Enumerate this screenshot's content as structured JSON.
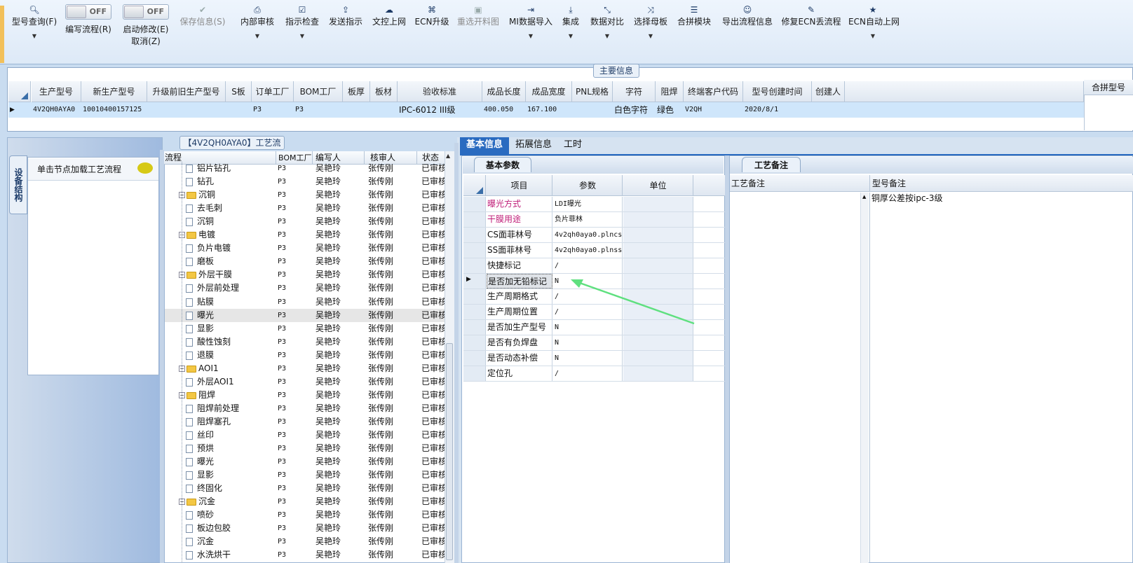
{
  "toolbar": {
    "items": [
      {
        "label": "型号查询(F)",
        "icon": "search-icon",
        "glyph": "🔍︎",
        "dropdown": true
      },
      {
        "label": "编写流程(R)",
        "toggle": "OFF"
      },
      {
        "label": "启动修改(E)",
        "label2": "取消(Z)",
        "toggle": "OFF"
      },
      {
        "label": "保存信息(S)",
        "icon": "check-icon",
        "glyph": "✔",
        "disabled": true
      },
      {
        "label": "内部审核",
        "icon": "printer-icon",
        "glyph": "⎙",
        "dropdown": true
      },
      {
        "label": "指示检查",
        "icon": "checkbox-icon",
        "glyph": "☑",
        "dropdown": true
      },
      {
        "label": "发送指示",
        "icon": "upload-icon",
        "glyph": "⇪"
      },
      {
        "label": "文控上网",
        "icon": "cloud-upload-icon",
        "glyph": "☁"
      },
      {
        "label": "ECN升级",
        "icon": "binoculars-icon",
        "glyph": "⌘"
      },
      {
        "label": "重选开料图",
        "icon": "image-icon",
        "glyph": "▣",
        "disabled": true
      },
      {
        "label": "MI数据导入",
        "icon": "import-icon",
        "glyph": "⇥",
        "dropdown": true
      },
      {
        "label": "集成",
        "icon": "download-icon",
        "glyph": "⤓",
        "dropdown": true
      },
      {
        "label": "数据对比",
        "icon": "compress-icon",
        "glyph": "⤡",
        "dropdown": true
      },
      {
        "label": "选择母板",
        "icon": "shuffle-icon",
        "glyph": "⤨",
        "dropdown": true
      },
      {
        "label": "合拼模块",
        "icon": "list-icon",
        "glyph": "☰"
      },
      {
        "label": "导出流程信息",
        "icon": "smile-icon",
        "glyph": "☺"
      },
      {
        "label": "修复ECN丢流程",
        "icon": "wrench-icon",
        "glyph": "✎"
      },
      {
        "label": "ECN自动上网",
        "icon": "star-icon",
        "glyph": "★",
        "dropdown": true
      }
    ]
  },
  "main_info": {
    "title": "主要信息",
    "columns": [
      "生产型号",
      "新生产型号",
      "升级前旧生产型号",
      "S板",
      "订单工厂",
      "BOM工厂",
      "板厚",
      "板材",
      "验收标准",
      "成品长度",
      "成品宽度",
      "PNL规格",
      "字符",
      "阻焊",
      "终端客户代码",
      "型号创建时间",
      "创建人"
    ],
    "row": [
      "4V2QH0AYA0",
      "10010400157125",
      "",
      "",
      "P3",
      "P3",
      "",
      "",
      "IPC-6012 III级",
      "400.050",
      "167.100",
      "",
      "白色字符",
      "绿色",
      "V2QH",
      "2020/8/1",
      ""
    ],
    "side_header": "合拼型号"
  },
  "left_panel": {
    "vertical_tab": "设备结构",
    "hint": "单击节点加载工艺流程"
  },
  "process": {
    "title": "【4V2QH0AYA0】工艺流程",
    "headers": [
      "流程",
      "BOM工厂",
      "编写人",
      "核审人",
      "状态"
    ],
    "rows": [
      {
        "name": "铝片钻孔",
        "type": "doc",
        "level": 2,
        "bom": "P3",
        "writer": "吴艳玲",
        "reviewer": "张传刚",
        "status": "已审核"
      },
      {
        "name": "钻孔",
        "type": "doc",
        "level": 2,
        "bom": "P3",
        "writer": "吴艳玲",
        "reviewer": "张传刚",
        "status": "已审核"
      },
      {
        "name": "沉铜",
        "type": "folder",
        "level": 1,
        "bom": "P3",
        "writer": "吴艳玲",
        "reviewer": "张传刚",
        "status": "已审核"
      },
      {
        "name": "去毛刺",
        "type": "doc",
        "level": 2,
        "bom": "P3",
        "writer": "吴艳玲",
        "reviewer": "张传刚",
        "status": "已审核"
      },
      {
        "name": "沉铜",
        "type": "doc",
        "level": 2,
        "bom": "P3",
        "writer": "吴艳玲",
        "reviewer": "张传刚",
        "status": "已审核"
      },
      {
        "name": "电镀",
        "type": "folder",
        "level": 1,
        "bom": "P3",
        "writer": "吴艳玲",
        "reviewer": "张传刚",
        "status": "已审核"
      },
      {
        "name": "负片电镀",
        "type": "doc",
        "level": 2,
        "bom": "P3",
        "writer": "吴艳玲",
        "reviewer": "张传刚",
        "status": "已审核"
      },
      {
        "name": "磨板",
        "type": "doc",
        "level": 2,
        "bom": "P3",
        "writer": "吴艳玲",
        "reviewer": "张传刚",
        "status": "已审核"
      },
      {
        "name": "外层干膜",
        "type": "folder",
        "level": 1,
        "bom": "P3",
        "writer": "吴艳玲",
        "reviewer": "张传刚",
        "status": "已审核"
      },
      {
        "name": "外层前处理",
        "type": "doc",
        "level": 2,
        "bom": "P3",
        "writer": "吴艳玲",
        "reviewer": "张传刚",
        "status": "已审核"
      },
      {
        "name": "贴膜",
        "type": "doc",
        "level": 2,
        "bom": "P3",
        "writer": "吴艳玲",
        "reviewer": "张传刚",
        "status": "已审核"
      },
      {
        "name": "曝光",
        "type": "doc",
        "level": 2,
        "bom": "P3",
        "writer": "吴艳玲",
        "reviewer": "张传刚",
        "status": "已审核",
        "selected": true
      },
      {
        "name": "显影",
        "type": "doc",
        "level": 2,
        "bom": "P3",
        "writer": "吴艳玲",
        "reviewer": "张传刚",
        "status": "已审核"
      },
      {
        "name": "酸性蚀刻",
        "type": "doc",
        "level": 2,
        "bom": "P3",
        "writer": "吴艳玲",
        "reviewer": "张传刚",
        "status": "已审核"
      },
      {
        "name": "退膜",
        "type": "doc",
        "level": 2,
        "bom": "P3",
        "writer": "吴艳玲",
        "reviewer": "张传刚",
        "status": "已审核"
      },
      {
        "name": "AOI1",
        "type": "folder",
        "level": 1,
        "bom": "P3",
        "writer": "吴艳玲",
        "reviewer": "张传刚",
        "status": "已审核"
      },
      {
        "name": "外层AOI1",
        "type": "doc",
        "level": 2,
        "bom": "P3",
        "writer": "吴艳玲",
        "reviewer": "张传刚",
        "status": "已审核"
      },
      {
        "name": "阻焊",
        "type": "folder",
        "level": 1,
        "bom": "P3",
        "writer": "吴艳玲",
        "reviewer": "张传刚",
        "status": "已审核"
      },
      {
        "name": "阻焊前处理",
        "type": "doc",
        "level": 2,
        "bom": "P3",
        "writer": "吴艳玲",
        "reviewer": "张传刚",
        "status": "已审核"
      },
      {
        "name": "阻焊塞孔",
        "type": "doc",
        "level": 2,
        "bom": "P3",
        "writer": "吴艳玲",
        "reviewer": "张传刚",
        "status": "已审核"
      },
      {
        "name": "丝印",
        "type": "doc",
        "level": 2,
        "bom": "P3",
        "writer": "吴艳玲",
        "reviewer": "张传刚",
        "status": "已审核"
      },
      {
        "name": "预烘",
        "type": "doc",
        "level": 2,
        "bom": "P3",
        "writer": "吴艳玲",
        "reviewer": "张传刚",
        "status": "已审核"
      },
      {
        "name": "曝光",
        "type": "doc",
        "level": 2,
        "bom": "P3",
        "writer": "吴艳玲",
        "reviewer": "张传刚",
        "status": "已审核"
      },
      {
        "name": "显影",
        "type": "doc",
        "level": 2,
        "bom": "P3",
        "writer": "吴艳玲",
        "reviewer": "张传刚",
        "status": "已审核"
      },
      {
        "name": "终固化",
        "type": "doc",
        "level": 2,
        "bom": "P3",
        "writer": "吴艳玲",
        "reviewer": "张传刚",
        "status": "已审核"
      },
      {
        "name": "沉金",
        "type": "folder",
        "level": 1,
        "bom": "P3",
        "writer": "吴艳玲",
        "reviewer": "张传刚",
        "status": "已审核"
      },
      {
        "name": "喷砂",
        "type": "doc",
        "level": 2,
        "bom": "P3",
        "writer": "吴艳玲",
        "reviewer": "张传刚",
        "status": "已审核"
      },
      {
        "name": "板边包胶",
        "type": "doc",
        "level": 2,
        "bom": "P3",
        "writer": "吴艳玲",
        "reviewer": "张传刚",
        "status": "已审核"
      },
      {
        "name": "沉金",
        "type": "doc",
        "level": 2,
        "bom": "P3",
        "writer": "吴艳玲",
        "reviewer": "张传刚",
        "status": "已审核"
      },
      {
        "name": "水洗烘干",
        "type": "doc",
        "level": 2,
        "bom": "P3",
        "writer": "吴艳玲",
        "reviewer": "张传刚",
        "status": "已审核"
      }
    ]
  },
  "tabs": [
    "基本信息",
    "拓展信息",
    "工时"
  ],
  "basic_params": {
    "subtab": "基本参数",
    "headers": [
      "项目",
      "参数",
      "单位"
    ],
    "rows": [
      {
        "item": "曝光方式",
        "value": "LDI曝光",
        "highlight": true
      },
      {
        "item": "干膜用途",
        "value": "负片菲林",
        "highlight": true
      },
      {
        "item": "CS面菲林号",
        "value": "4v2qh0aya0.plncs"
      },
      {
        "item": "SS面菲林号",
        "value": "4v2qh0aya0.plnss"
      },
      {
        "item": "快捷标记",
        "value": "/"
      },
      {
        "item": "是否加无铅标记",
        "value": "N",
        "current": true
      },
      {
        "item": "生产周期格式",
        "value": "/"
      },
      {
        "item": "生产周期位置",
        "value": "/"
      },
      {
        "item": "是否加生产型号",
        "value": "N"
      },
      {
        "item": "是否有负焊盘",
        "value": "N"
      },
      {
        "item": "是否动态补偿",
        "value": "N"
      },
      {
        "item": "定位孔",
        "value": "/"
      }
    ]
  },
  "process_notes": {
    "tab": "工艺备注",
    "headers": [
      "工艺备注",
      "型号备注"
    ],
    "model_note": "铜厚公差按ipc-3级"
  },
  "colors": {
    "accent": "#2a6bc0",
    "highlight_text": "#c0207a",
    "arrow": "#5fe07f"
  }
}
